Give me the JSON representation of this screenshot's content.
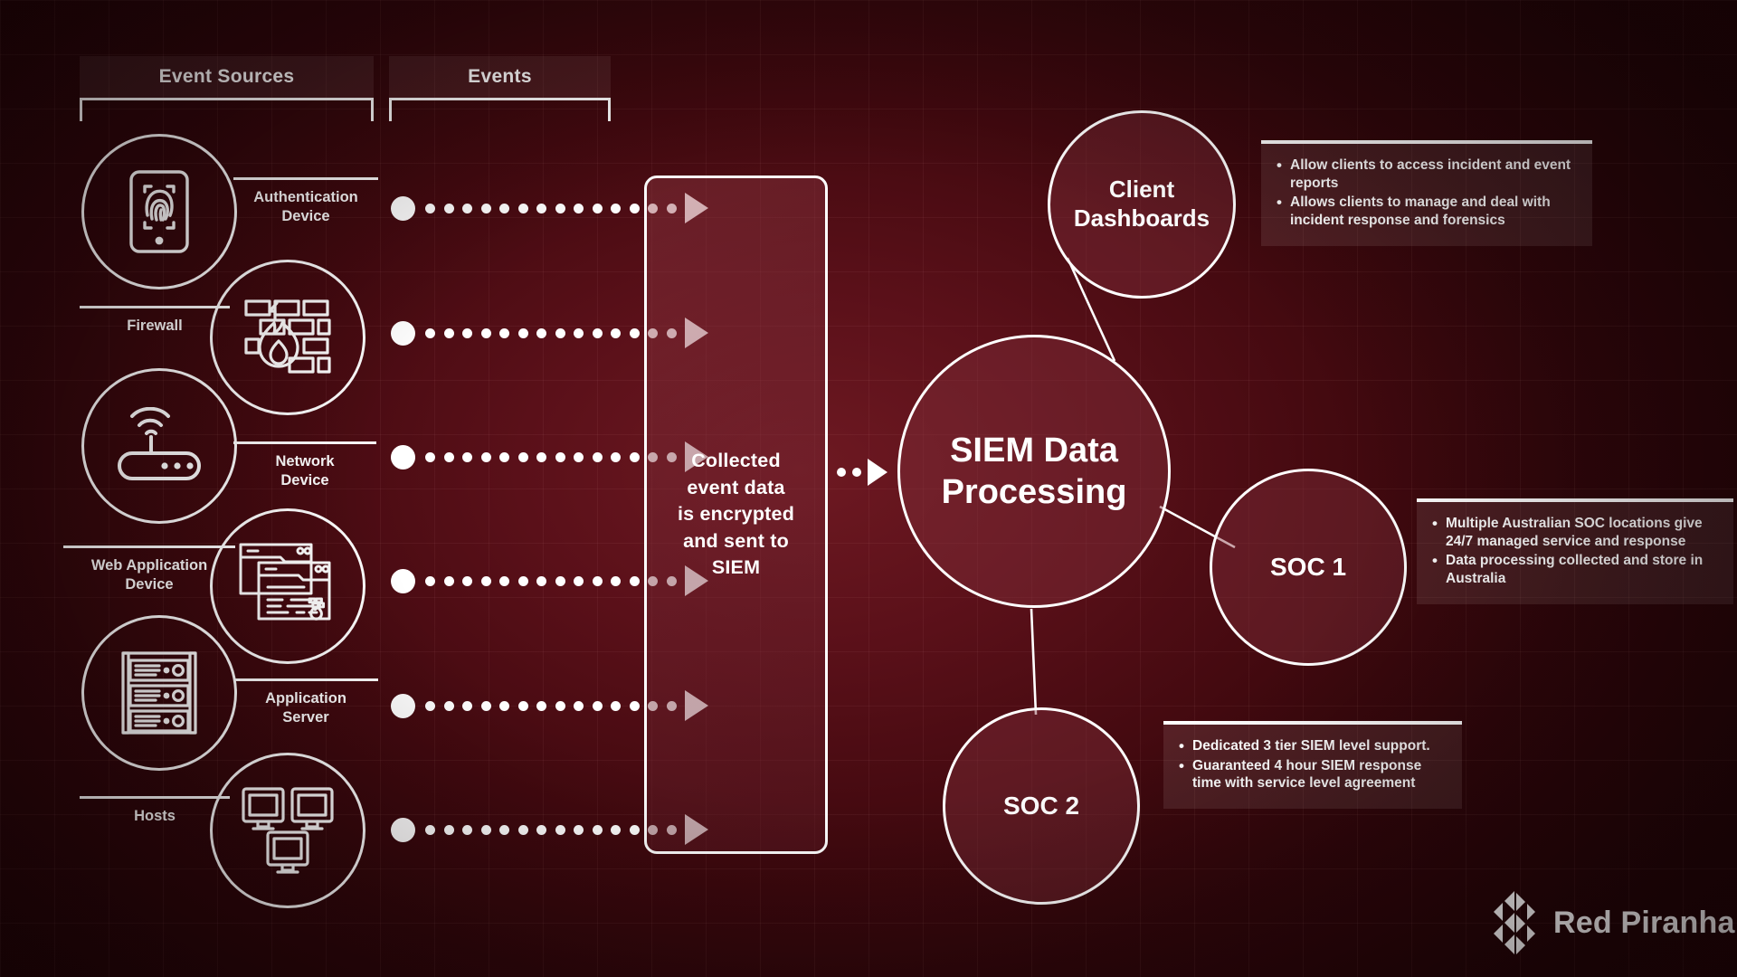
{
  "meta": {
    "title": "SIEM Event Flow Diagram",
    "brand": "Red Piranha",
    "colors": {
      "background_dark": "#2e060a",
      "background_mid": "#5a1019",
      "background_light": "#6e1922",
      "stroke": "#ffffff",
      "panel_fill": "rgba(255,232,232,0.10)"
    }
  },
  "columns": [
    {
      "id": "event-sources",
      "label": "Event Sources"
    },
    {
      "id": "events",
      "label": "Events"
    }
  ],
  "event_sources": [
    {
      "id": "authentication-device",
      "label": "Authentication\nDevice",
      "icon": "fingerprint-phone-icon"
    },
    {
      "id": "firewall",
      "label": "Firewall",
      "icon": "firewall-brick-flame-icon"
    },
    {
      "id": "network-device",
      "label": "Network\nDevice",
      "icon": "wifi-router-icon"
    },
    {
      "id": "web-application-device",
      "label": "Web Application\nDevice",
      "icon": "browser-windows-icon"
    },
    {
      "id": "application-server",
      "label": "Application\nServer",
      "icon": "server-rack-icon"
    },
    {
      "id": "hosts",
      "label": "Hosts",
      "icon": "monitors-icon"
    }
  ],
  "event_arrows": {
    "count": 6,
    "dot_count": 14,
    "style": "dotted-arrow-right"
  },
  "collector": {
    "id": "collected-event-data",
    "text": "Collected\nevent data\nis encrypted\nand sent to\nSIEM"
  },
  "processor": {
    "id": "siem-data-processing",
    "label": "SIEM Data\nProcessing",
    "font_size": "38px"
  },
  "nodes": [
    {
      "id": "client-dashboards",
      "label": "Client\nDashboards",
      "font_size": "26px",
      "bullets": [
        "Allow clients to access  incident and event reports",
        "Allows clients to manage and deal with incident response and forensics"
      ]
    },
    {
      "id": "soc-1",
      "label": "SOC 1",
      "font_size": "28px",
      "bullets": [
        "Multiple Australian SOC locations give 24/7 managed service and response",
        "Data processing collected and store in Australia"
      ]
    },
    {
      "id": "soc-2",
      "label": "SOC 2",
      "font_size": "28px",
      "bullets": [
        "Dedicated 3 tier SIEM level support.",
        "Guaranteed 4 hour SIEM response time with service level agreement"
      ]
    }
  ],
  "logo": {
    "text": "Red Piranha",
    "mark": "piranha-diamond-icon"
  }
}
